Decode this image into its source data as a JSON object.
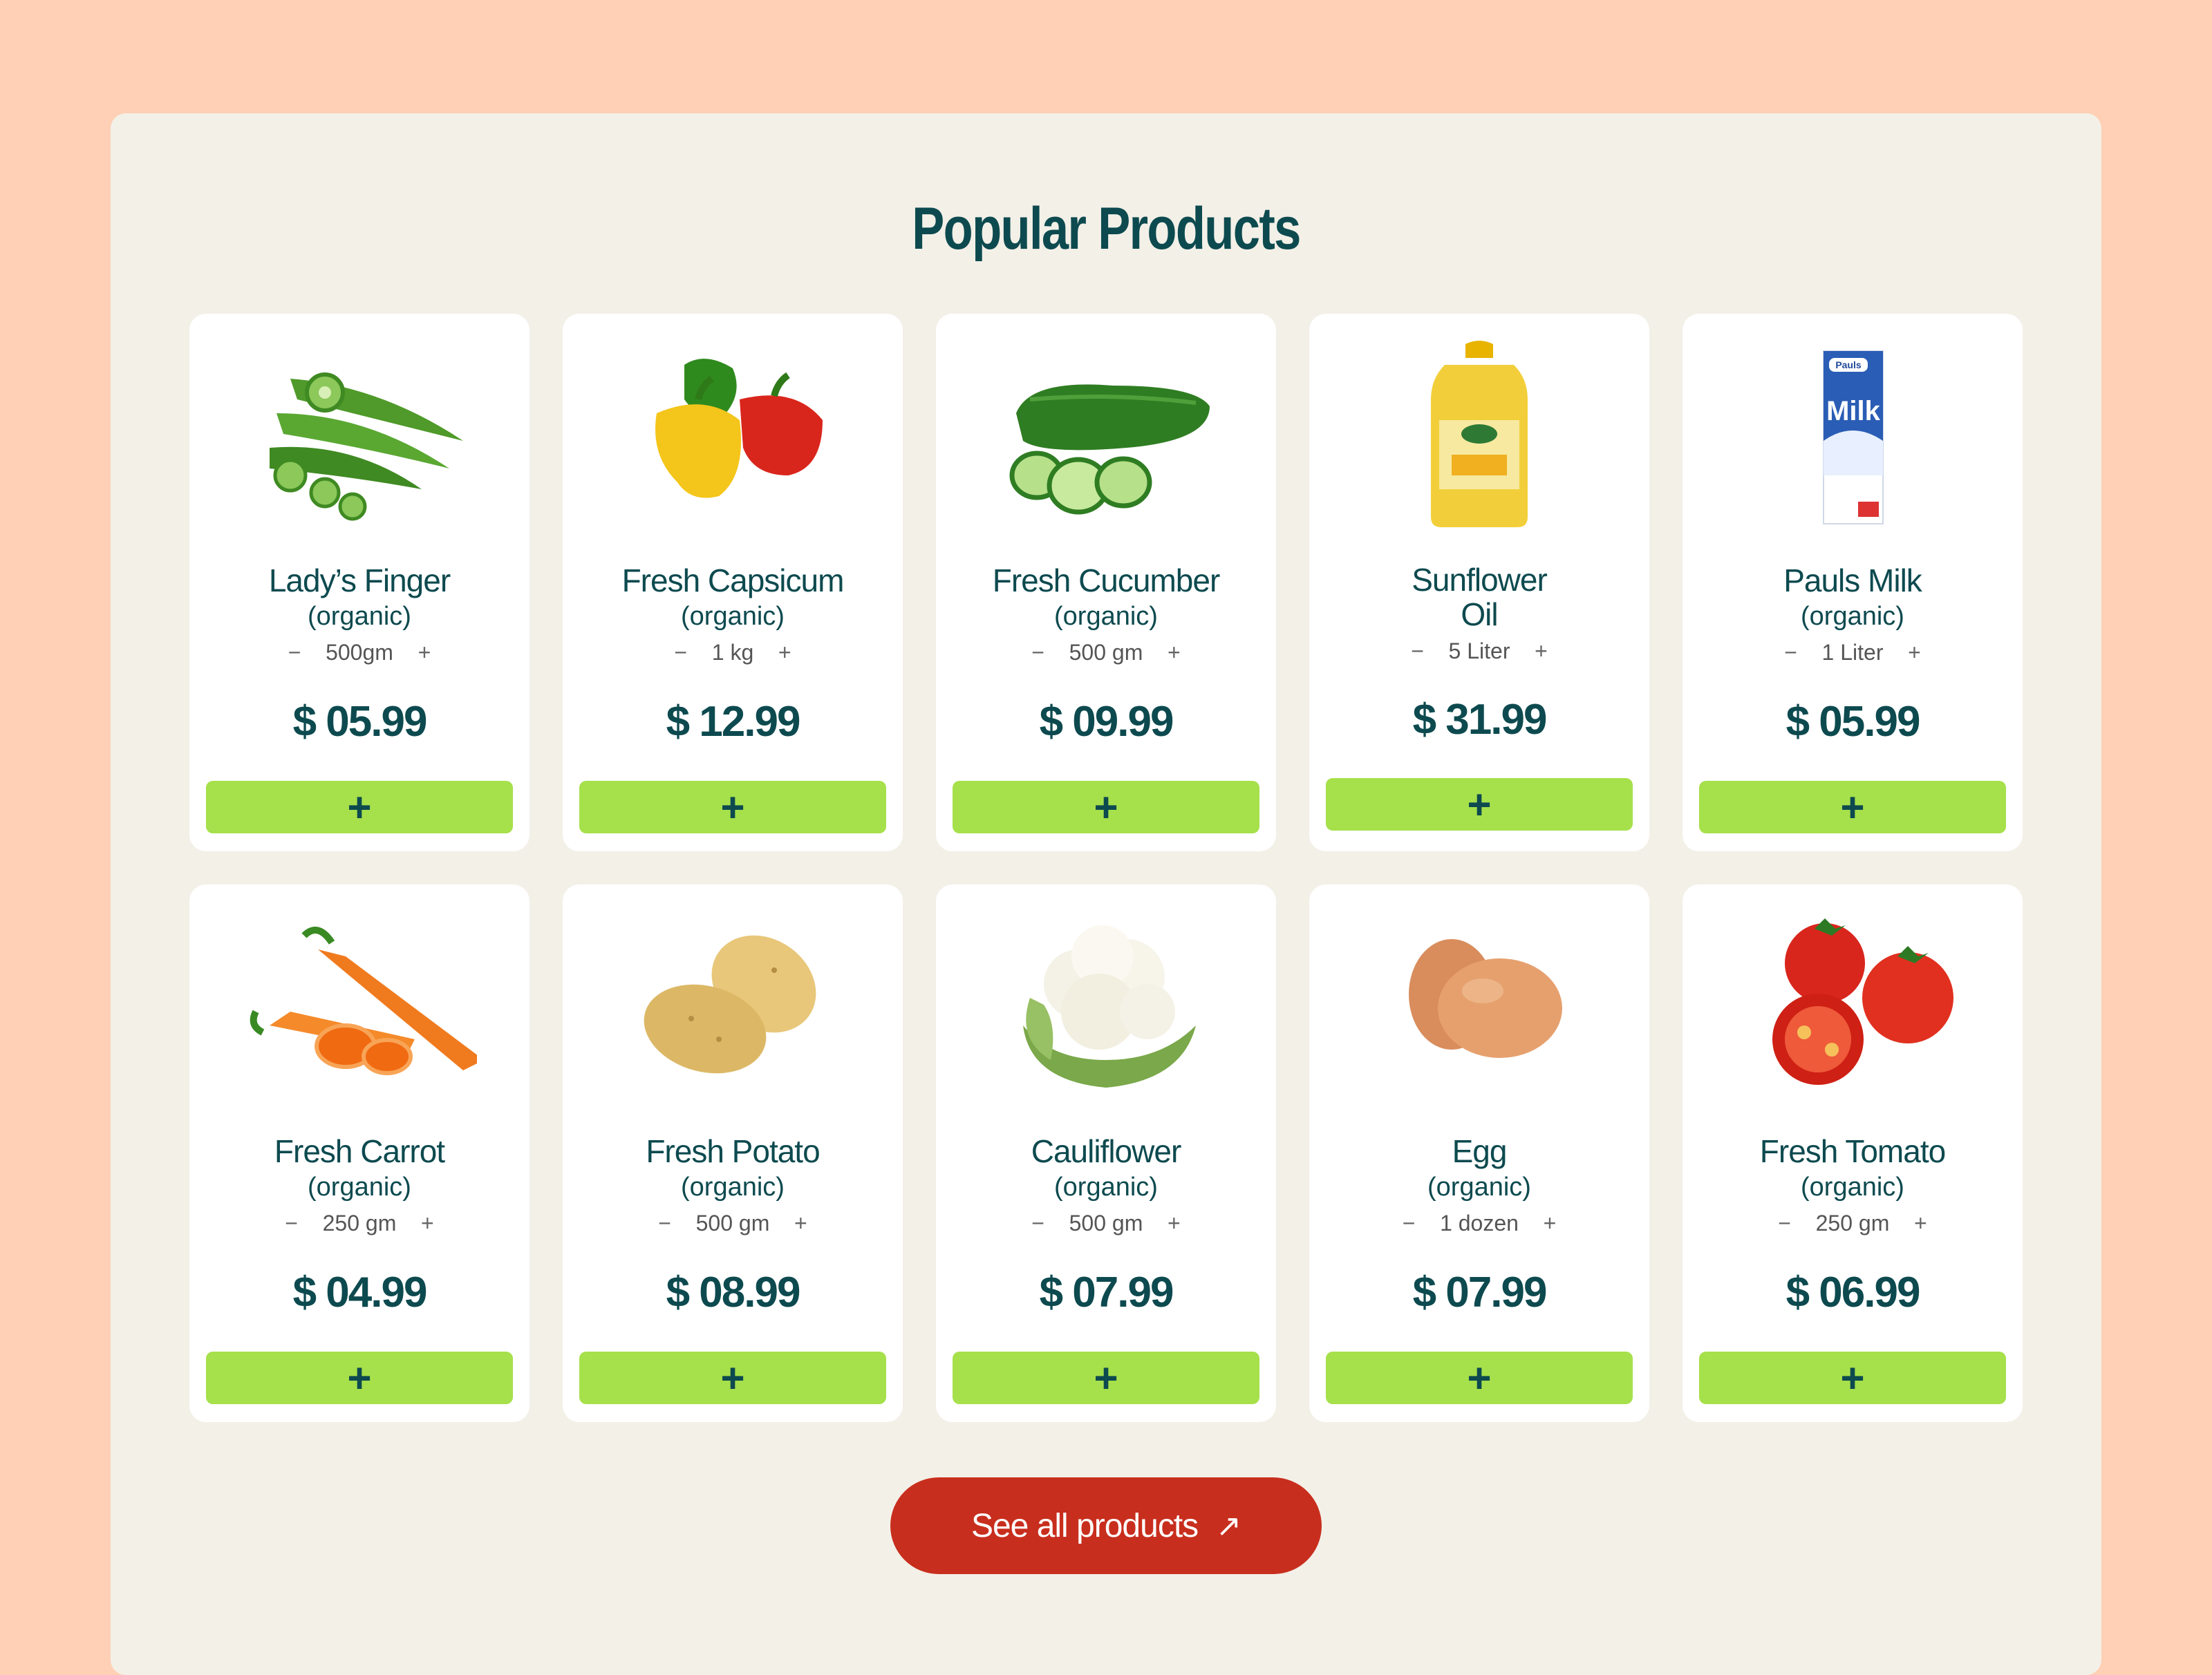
{
  "section_title": "Popular Products",
  "colors": {
    "background": "#ffd0b5",
    "panel": "#f3f0e8",
    "card": "#ffffff",
    "text": "#0d4a4f",
    "add_button": "#a6e04b",
    "cta": "#c82e1d"
  },
  "products": [
    {
      "name": "Lady’s Finger",
      "sub": "(organic)",
      "qty": "500gm",
      "price": "$ 05.99",
      "add": "+",
      "minus": "−",
      "plus": "+",
      "icon": "okra-image"
    },
    {
      "name": "Fresh Capsicum",
      "sub": "(organic)",
      "qty": "1 kg",
      "price": "$ 12.99",
      "add": "+",
      "minus": "−",
      "plus": "+",
      "icon": "capsicum-image"
    },
    {
      "name": "Fresh Cucumber",
      "sub": "(organic)",
      "qty": "500 gm",
      "price": "$ 09.99",
      "add": "+",
      "minus": "−",
      "plus": "+",
      "icon": "cucumber-image"
    },
    {
      "name": "Sunflower Oil",
      "sub": "",
      "qty": "5 Liter",
      "price": "$ 31.99",
      "add": "+",
      "minus": "−",
      "plus": "+",
      "icon": "oil-bottle-image"
    },
    {
      "name": "Pauls Milk",
      "sub": "(organic)",
      "qty": "1 Liter",
      "price": "$ 05.99",
      "add": "+",
      "minus": "−",
      "plus": "+",
      "icon": "milk-carton-image"
    },
    {
      "name": "Fresh Carrot",
      "sub": "(organic)",
      "qty": "250 gm",
      "price": "$ 04.99",
      "add": "+",
      "minus": "−",
      "plus": "+",
      "icon": "carrot-image"
    },
    {
      "name": "Fresh Potato",
      "sub": "(organic)",
      "qty": "500 gm",
      "price": "$ 08.99",
      "add": "+",
      "minus": "−",
      "plus": "+",
      "icon": "potato-image"
    },
    {
      "name": "Cauliflower",
      "sub": "(organic)",
      "qty": "500 gm",
      "price": "$ 07.99",
      "add": "+",
      "minus": "−",
      "plus": "+",
      "icon": "cauliflower-image"
    },
    {
      "name": "Egg",
      "sub": "(organic)",
      "qty": "1 dozen",
      "price": "$ 07.99",
      "add": "+",
      "minus": "−",
      "plus": "+",
      "icon": "egg-image"
    },
    {
      "name": "Fresh Tomato",
      "sub": "(organic)",
      "qty": "250 gm",
      "price": "$ 06.99",
      "add": "+",
      "minus": "−",
      "plus": "+",
      "icon": "tomato-image"
    }
  ],
  "milk_brand": "Pauls",
  "milk_label": "Milk",
  "see_all": {
    "label": "See all products",
    "arrow": "↗",
    "icon": "arrow-up-right-icon"
  }
}
